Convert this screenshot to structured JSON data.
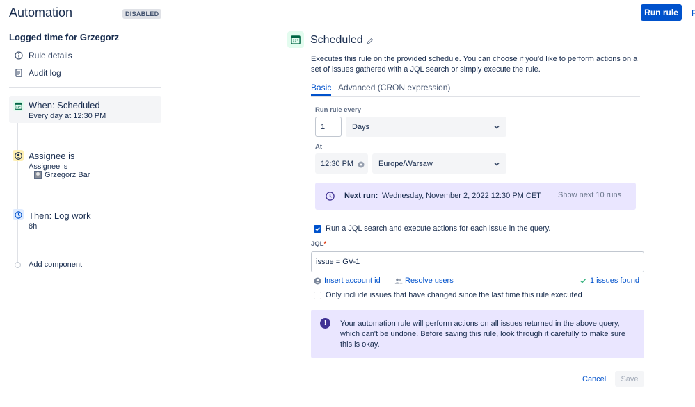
{
  "header": {
    "title": "Automation",
    "status_badge": "DISABLED",
    "run_rule_label": "Run rule",
    "cut_off_link": "R"
  },
  "left_panel": {
    "rule_name": "Logged time for Grzegorz",
    "links": [
      {
        "label": "Rule details",
        "icon": "info-icon"
      },
      {
        "label": "Audit log",
        "icon": "document-icon"
      }
    ],
    "steps": [
      {
        "title": "When: Scheduled",
        "subtitle": "Every day at 12:30 PM",
        "icon": "calendar-icon",
        "color": "#36b37e"
      },
      {
        "title": "Assignee is",
        "subtitle": "Assignee is",
        "user": "Grzegorz Bar",
        "icon": "user-circle-icon",
        "color": "#ffc400"
      },
      {
        "title": "Then: Log work",
        "subtitle": "8h",
        "icon": "clock-icon",
        "color": "#0065ff"
      }
    ],
    "add_component": "Add component"
  },
  "main": {
    "title": "Scheduled",
    "description": "Executes this rule on the provided schedule. You can choose if you'd like to perform actions on a set of issues gathered with a JQL search or simply execute the rule.",
    "tabs": [
      {
        "label": "Basic",
        "active": true
      },
      {
        "label": "Advanced (CRON expression)",
        "active": false
      }
    ],
    "run_every": {
      "label": "Run rule every",
      "value": "1",
      "unit": "Days"
    },
    "at": {
      "label": "At",
      "time": "12:30 PM",
      "timezone": "Europe/Warsaw"
    },
    "next_run": {
      "label": "Next run:",
      "value": "Wednesday, November 2, 2022 12:30 PM CET",
      "show_next": "Show next 10 runs"
    },
    "jql_checkbox": {
      "label": "Run a JQL search and execute actions for each issue in the query.",
      "checked": true
    },
    "jql": {
      "label": "JQL",
      "required_mark": "*",
      "value": "issue = GV-1",
      "insert_account_id": "Insert account id",
      "resolve_users": "Resolve users",
      "issues_found": "1 issues found"
    },
    "changed_checkbox": {
      "label": "Only include issues that have changed since the last time this rule executed",
      "checked": false
    },
    "warning": "Your automation rule will perform actions on all issues returned in the above query, which can't be undone. Before saving this rule, look through it carefully to make sure this is okay.",
    "cancel_label": "Cancel",
    "save_label": "Save"
  },
  "colors": {
    "primary": "#0052cc",
    "info_bg": "#eae6ff",
    "discovery": "#403294"
  }
}
